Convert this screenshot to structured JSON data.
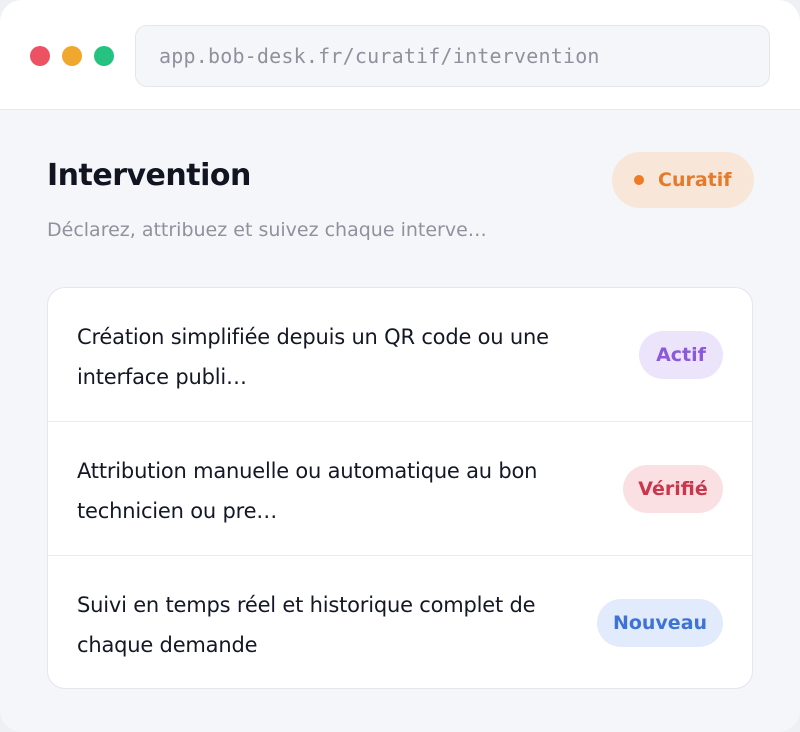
{
  "window": {
    "url": "app.bob-desk.fr/curatif/intervention"
  },
  "header": {
    "title": "Intervention",
    "subtitle": "Déclarez, attribuez et suivez chaque interve…",
    "category_badge": "Curatif"
  },
  "colors": {
    "accent_orange": "#ee7a22",
    "status_actif": "#8c5ad8",
    "status_verifie": "#c9374c",
    "status_nouveau": "#3e73d6"
  },
  "items": [
    {
      "text": "Création simplifiée depuis un QR code ou une interface publi…",
      "status": "Actif"
    },
    {
      "text": "Attribution manuelle ou automatique au bon technicien ou pre…",
      "status": "Vérifié"
    },
    {
      "text": "Suivi en temps réel et historique complet de chaque demande",
      "status": "Nouveau"
    }
  ]
}
